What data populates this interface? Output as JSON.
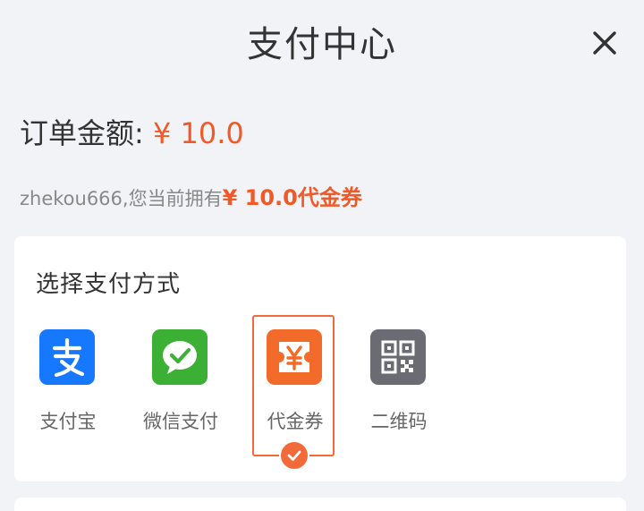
{
  "header": {
    "title": "支付中心",
    "close_icon": "close-icon"
  },
  "order": {
    "label": "订单金额:",
    "amount": "¥ 10.0"
  },
  "voucher_notice": {
    "prefix": "zhekou666,您当前拥有",
    "highlight": "¥ 10.0代金券"
  },
  "payment": {
    "section_title": "选择支付方式",
    "selected": "代金券",
    "methods": [
      {
        "label": "支付宝",
        "icon": "alipay-icon",
        "color": "#1677ff"
      },
      {
        "label": "微信支付",
        "icon": "wechat-pay-icon",
        "color": "#3cb034"
      },
      {
        "label": "代金券",
        "icon": "voucher-icon",
        "color": "#f36b2b"
      },
      {
        "label": "二维码",
        "icon": "qr-code-icon",
        "color": "#6b6b73"
      }
    ]
  },
  "colors": {
    "accent": "#f05a28",
    "background": "#f1f3f6"
  }
}
